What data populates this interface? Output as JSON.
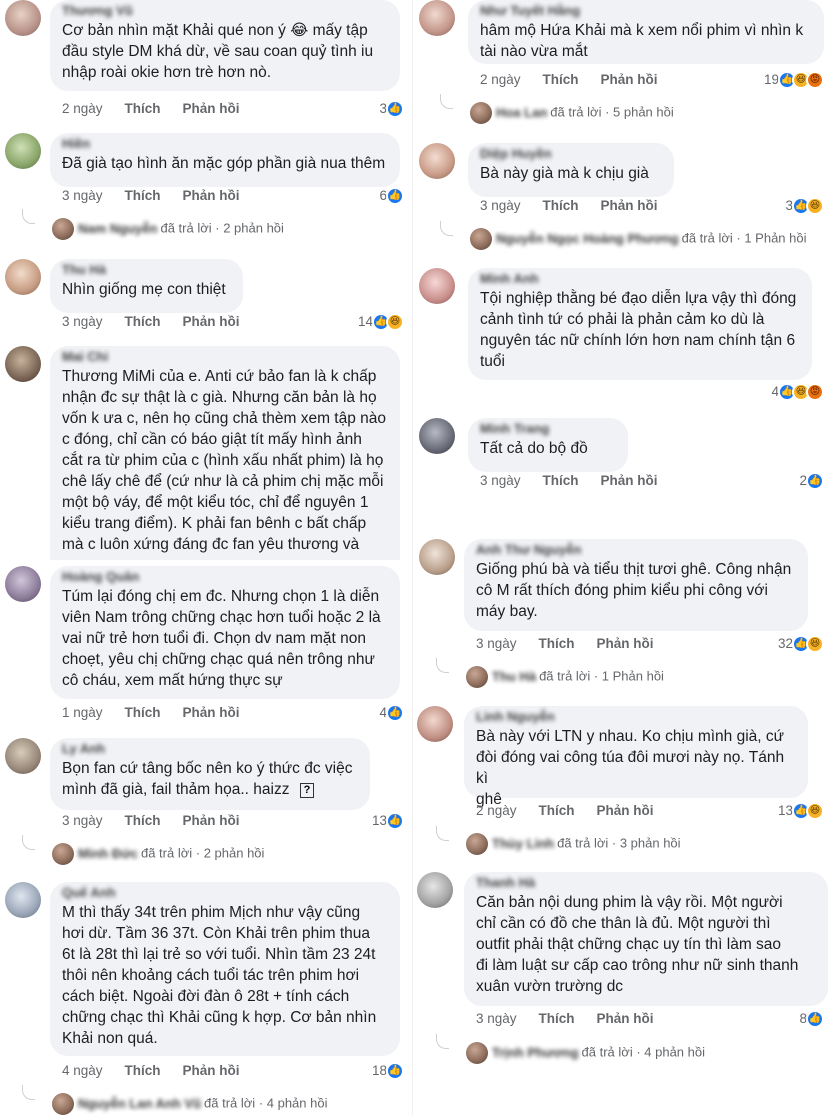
{
  "left": [
    {
      "author": "Thương Vũ",
      "text": "Cơ bản nhìn mặt Khải qué non ý 😂 mấy tập\nđầu style DM khá dừ, về sau coan quỷ tình iu\nnhập roài okie hơn trè hơn nò.",
      "time": "2 ngày",
      "like": "Thích",
      "reply": "Phản hồi",
      "count": "3",
      "icons": [
        "like-icon"
      ]
    },
    {
      "author": "Hiền",
      "text": "Đã già tạo hình ăn mặc góp phần già nua thêm",
      "time": "3 ngày",
      "like": "Thích",
      "reply": "Phản hồi",
      "count": "6",
      "icons": [
        "like-icon"
      ],
      "replies": {
        "name": "Nam Nguyễn",
        "text": "đã trả lời",
        "count": "· 2 phản hồi"
      }
    },
    {
      "author": "Thu Hà",
      "text": "Nhìn giống mẹ con thiệt",
      "time": "3 ngày",
      "like": "Thích",
      "reply": "Phản hồi",
      "count": "14",
      "icons": [
        "like-icon",
        "haha-icon"
      ]
    },
    {
      "author": "Mai Chi",
      "text": "Thương MiMi của e. Anti cứ bảo fan là k chấp\nnhận đc sự thật là c già. Nhưng căn bản là họ\nvốn k ưa c, nên họ cũng chả thèm xem tập nào\nc đóng, chỉ cần có báo giật tít mấy hình ảnh\ncắt ra từ phim của c (hình xấu nhất phim) là họ\nchê lấy chê để (cứ như là cả phim chị mặc mỗi\nmột bộ váy, để một kiểu tóc, chỉ để nguyên 1\nkiểu trang điểm). K phải fan bênh c bất chấp\nmà c luôn xứng đáng đc fan yêu thương và"
    },
    {
      "author": "Hoàng Quân",
      "text": "Túm lại đóng chị em đc. Nhưng chọn 1 là diễn\nviên Nam trông chững chạc hơn tuổi hoặc 2 là\nvai nữ trẻ hơn tuổi đi. Chọn dv nam mặt non\nchoẹt, yêu chị chững chạc quá nên trông như\ncô cháu, xem mất hứng thực sự",
      "time": "1 ngày",
      "like": "Thích",
      "reply": "Phản hồi",
      "count": "4",
      "icons": [
        "like-icon"
      ]
    },
    {
      "author": "Ly Anh",
      "text": "Bọn fan cứ tâng bốc nên ko ý thức đc việc\nmình đã già, fail thảm họa.. haizz",
      "time": "3 ngày",
      "like": "Thích",
      "reply": "Phản hồi",
      "count": "13",
      "icons": [
        "like-icon"
      ],
      "replies": {
        "name": "Minh Đức",
        "text": "đã trả lời",
        "count": "· 2 phản hồi"
      }
    },
    {
      "author": "Quế Anh",
      "text": "M thì thấy 34t trên phim Mịch như vậy cũng\nhơi dừ. Tầm 36 37t. Còn Khải trên phim thua\n6t là 28t thì lại trẻ so với tuổi. Nhìn tầm 23 24t\nthôi nên khoảng cách tuổi tác trên phim hơi\ncách biệt. Ngoài đời đàn ô 28t + tính cách\nchững chạc thì Khải cũng k hợp. Cơ bản nhìn\nKhải non quá.",
      "time": "4 ngày",
      "like": "Thích",
      "reply": "Phản hồi",
      "count": "18",
      "icons": [
        "like-icon"
      ],
      "replies": {
        "name": "Nguyễn Lan Anh Vũ",
        "text": "đã trả lời",
        "count": "· 4 phản hồi"
      }
    }
  ],
  "right": [
    {
      "author": "Như Tuyết Hằng",
      "text": "hâm mộ Hứa Khải mà k xem nổi phim vì nhìn k\ntài nào vừa mắt",
      "time": "2 ngày",
      "like": "Thích",
      "reply": "Phản hồi",
      "count": "19",
      "icons": [
        "like-icon",
        "haha-icon",
        "angry-icon"
      ],
      "replies": {
        "name": "Hoa Lan",
        "text": "đã trả lời",
        "count": "· 5 phản hồi"
      }
    },
    {
      "author": "Diệp Huyền",
      "text": "Bà này già mà k chịu già",
      "time": "3 ngày",
      "like": "Thích",
      "reply": "Phản hồi",
      "count": "3",
      "icons": [
        "like-icon",
        "haha-icon"
      ],
      "replies": {
        "name": "Nguyễn Ngọc Hoàng Phương",
        "text": "đã trả lời",
        "count": "· 1 Phản hồi"
      }
    },
    {
      "author": "Minh Anh",
      "text": "Tội nghiệp thằng bé đạo diễn lựa vậy thì đóng\ncảnh tình tứ có phải là phản cảm ko dù là\nnguyên tác nữ chính lớn hơn nam chính tận 6\ntuổi",
      "time": "",
      "like": "",
      "reply": "",
      "count": "4",
      "icons": [
        "like-icon",
        "haha-icon",
        "angry-icon"
      ]
    },
    {
      "author": "Minh Trang",
      "text": "Tất cả do bộ đồ",
      "time": "3 ngày",
      "like": "Thích",
      "reply": "Phản hồi",
      "count": "2",
      "icons": [
        "like-icon"
      ]
    },
    {
      "author": "Anh Thư Nguyễn",
      "text": "Giống phú bà và tiểu thịt tươi ghê. Công nhận\ncô M rất thích đóng phim kiểu phi công với\nmáy bay.",
      "time": "3 ngày",
      "like": "Thích",
      "reply": "Phản hồi",
      "count": "32",
      "icons": [
        "like-icon",
        "haha-icon"
      ],
      "replies": {
        "name": "Thu Hà",
        "text": "đã trả lời",
        "count": "· 1 Phản hồi"
      }
    },
    {
      "author": "Linh Nguyễn",
      "text": "Bà này với LTN y nhau. Ko chịu mình già, cứ\nđòi đóng vai công túa đôi mươi này nọ. Tánh kì\nghê",
      "time": "2 ngày",
      "like": "Thích",
      "reply": "Phản hồi",
      "count": "13",
      "icons": [
        "like-icon",
        "haha-icon"
      ],
      "replies": {
        "name": "Thùy Linh",
        "text": "đã trả lời",
        "count": "· 3 phản hồi"
      }
    },
    {
      "author": "Thanh Hà",
      "text": "Căn bản nội dung phim là vậy rồi. Một người\nchỉ cần có đồ che thân là đủ. Một người thì\noutfit phải thật chững chạc uy tín thì làm sao\nđi làm luật sư cấp cao trông như nữ sinh thanh\nxuân vườn trường dc",
      "time": "3 ngày",
      "like": "Thích",
      "reply": "Phản hồi",
      "count": "8",
      "icons": [
        "like-icon"
      ],
      "replies": {
        "name": "Trịnh Phương",
        "text": "đã trả lời",
        "count": "· 4 phản hồi"
      }
    }
  ],
  "colors": {
    "bubble": "#f0f2f5",
    "meta": "#65676b",
    "like": "#1877f2",
    "haha": "#f7b125",
    "angry": "#e9710f"
  }
}
